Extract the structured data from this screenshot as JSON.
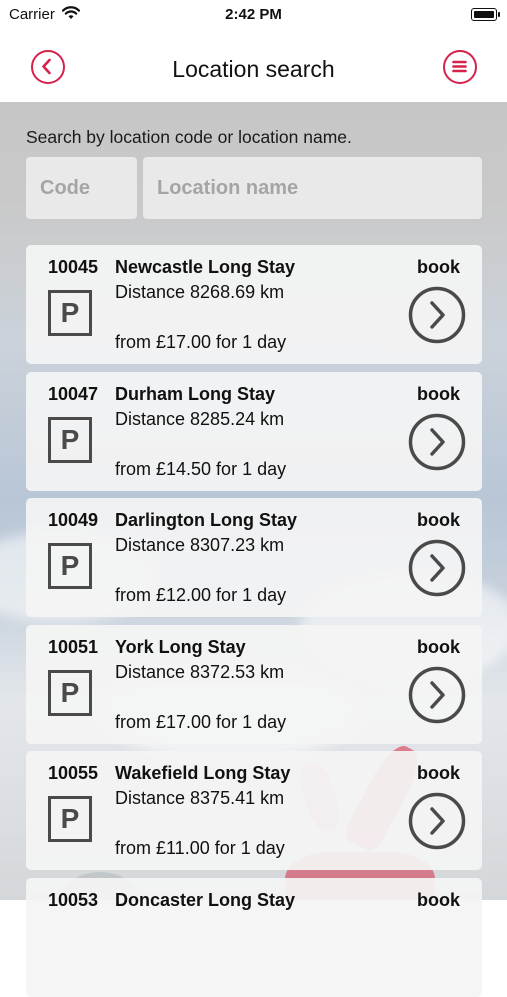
{
  "status": {
    "carrier": "Carrier",
    "time": "2:42 PM"
  },
  "nav": {
    "title": "Location search",
    "back_icon": "back-circle-icon",
    "menu_icon": "menu-circle-icon",
    "accent": "#d6214b"
  },
  "search": {
    "prompt": "Search by location code or location name.",
    "code_placeholder": "Code",
    "name_placeholder": "Location name"
  },
  "locations": [
    {
      "code": "10045",
      "name": "Newcastle Long Stay",
      "distance": "Distance 8268.69 km",
      "price": "from £17.00 for 1 day",
      "action": "book"
    },
    {
      "code": "10047",
      "name": "Durham Long Stay",
      "distance": "Distance 8285.24 km",
      "price": "from £14.50 for 1 day",
      "action": "book"
    },
    {
      "code": "10049",
      "name": "Darlington Long Stay",
      "distance": "Distance 8307.23 km",
      "price": "from £12.00 for 1 day",
      "action": "book"
    },
    {
      "code": "10051",
      "name": "York Long Stay",
      "distance": "Distance 8372.53 km",
      "price": "from £17.00 for 1 day",
      "action": "book"
    },
    {
      "code": "10055",
      "name": "Wakefield Long Stay",
      "distance": "Distance 8375.41 km",
      "price": "from £11.00 for 1 day",
      "action": "book"
    },
    {
      "code": "10053",
      "name": "Doncaster Long Stay",
      "distance": "",
      "price": "",
      "action": "book"
    }
  ],
  "icons": {
    "parking": "P"
  }
}
